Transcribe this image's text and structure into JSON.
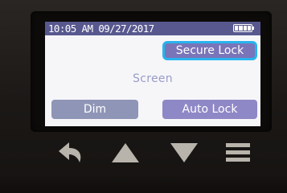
{
  "status_bar": {
    "datetime": "10:05 AM 09/27/2017",
    "battery_icon": "battery-full-icon"
  },
  "screen": {
    "label": "Screen",
    "selected_button": "secure_lock",
    "buttons": {
      "secure_lock": "Secure Lock",
      "dim": "Dim",
      "auto_lock": "Auto Lock"
    }
  },
  "hardware_buttons": [
    {
      "icon": "back-arrow-icon"
    },
    {
      "icon": "up-triangle-icon"
    },
    {
      "icon": "down-triangle-icon"
    },
    {
      "icon": "menu-icon"
    }
  ],
  "colors": {
    "status_bar": "#58588f",
    "selection_outline": "#27b4ee",
    "button_purple": "#7a74b8",
    "button_dim": "#8f95b6",
    "label_text": "#9a9cc8",
    "hw_icon": "#b8b4ab"
  }
}
